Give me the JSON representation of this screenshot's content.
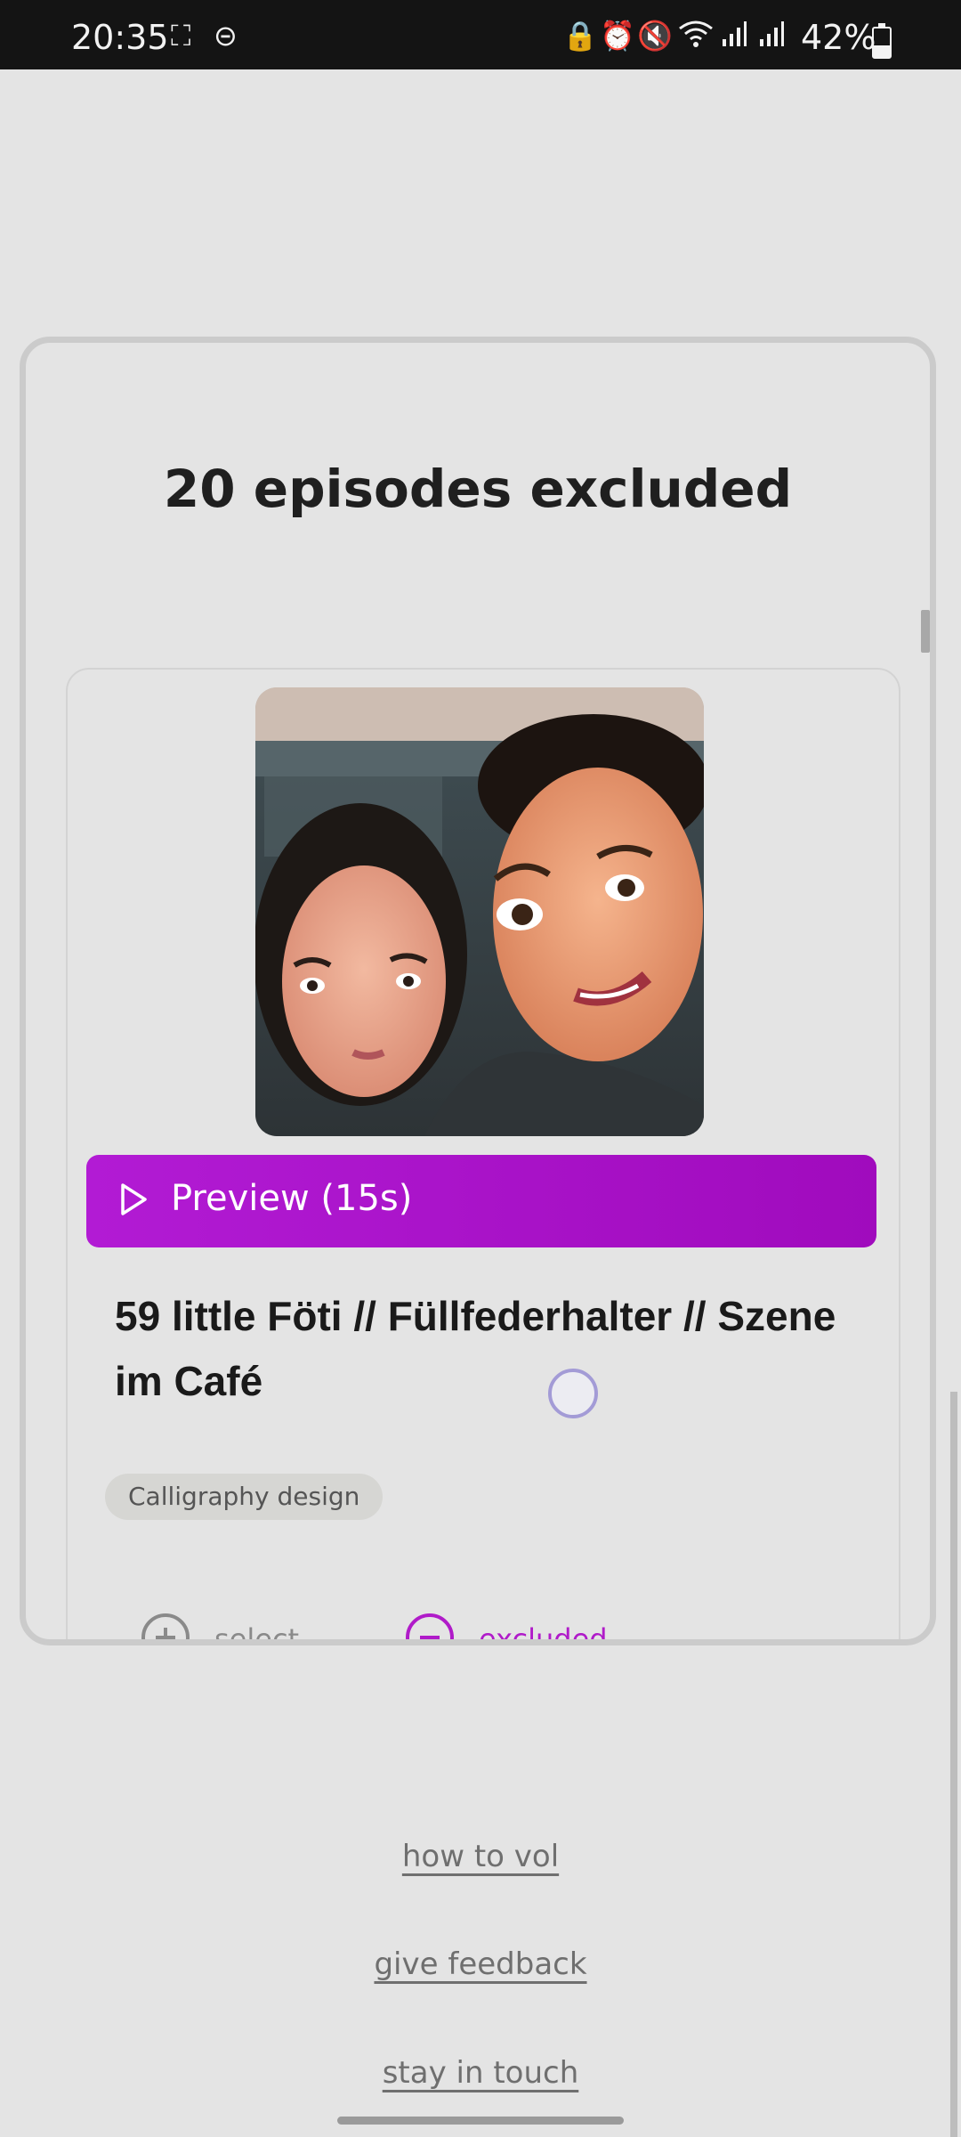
{
  "status_bar": {
    "time": "20:35",
    "battery_text": "42%",
    "battery_level": 0.42,
    "left_icons": [
      "screenshot-frame-icon",
      "do-not-disturb-icon"
    ],
    "right_icons": [
      "vpn-lock-icon",
      "alarm-icon",
      "mute-icon",
      "wifi-icon",
      "signal-icon",
      "signal-icon"
    ]
  },
  "modal": {
    "title": "20 episodes excluded",
    "episode": {
      "preview_label": "Preview (15s)",
      "title": "59 little Föti // Füllfederhalter // Szene im Café",
      "tag": "Calligraphy design",
      "actions": {
        "select_label": "select",
        "excluded_label": "excluded"
      }
    }
  },
  "footer": {
    "links": [
      "how to vol",
      "give feedback",
      "stay in touch"
    ]
  },
  "colors": {
    "accent": "#b01bc9",
    "background": "#e4e4e4",
    "status_bar": "#141414"
  }
}
